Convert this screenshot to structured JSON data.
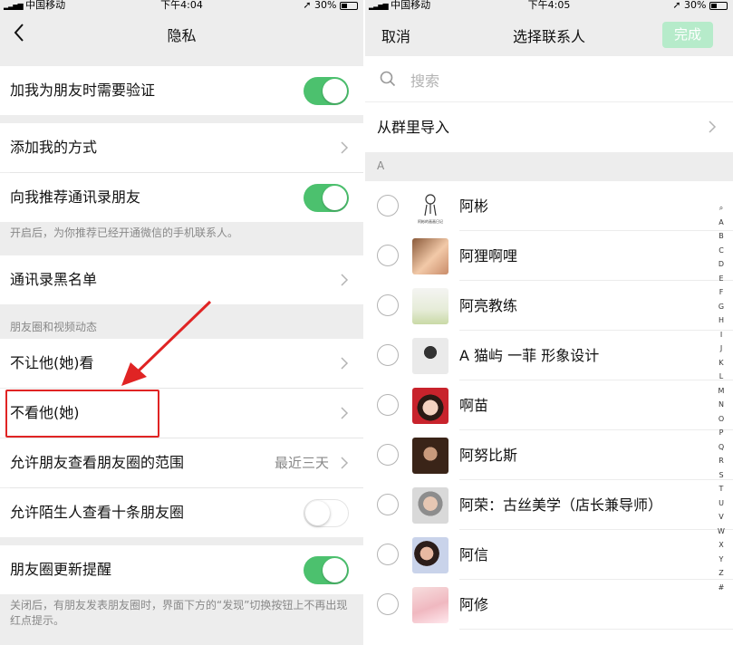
{
  "left": {
    "status": {
      "carrier": "中国移动",
      "time": "下午4:04",
      "battery": "30%"
    },
    "nav": {
      "title": "隐私"
    },
    "items": {
      "verify": "加我为朋友时需要验证",
      "add_methods": "添加我的方式",
      "recommend": "向我推荐通讯录朋友",
      "recommend_note": "开启后，为你推荐已经开通微信的手机联系人。",
      "blacklist": "通讯录黑名单",
      "moments_section": "朋友圈和视频动态",
      "hide_from": "不让他(她)看",
      "dont_see": "不看他(她)",
      "range": "允许朋友查看朋友圈的范围",
      "range_value": "最近三天",
      "strangers": "允许陌生人查看十条朋友圈",
      "moments_update": "朋友圈更新提醒",
      "update_note": "关闭后，有朋友发表朋友圈时，界面下方的“发现”切换按钮上不再出现红点提示。"
    },
    "toggles": {
      "verify": true,
      "recommend": true,
      "strangers": false,
      "moments_update": true
    }
  },
  "right": {
    "status": {
      "carrier": "中国移动",
      "time": "下午4:05",
      "battery": "30%"
    },
    "nav": {
      "cancel": "取消",
      "title": "选择联系人",
      "done": "完成"
    },
    "search": {
      "placeholder": "搜索"
    },
    "from_group": "从群里导入",
    "letter_header": "A",
    "avatar_caption": "阿彬的画画日记",
    "contacts": [
      "阿彬",
      "阿狸啊哩",
      "阿亮教练",
      "A 猫屿 一菲  形象设计",
      "啊苗",
      "阿努比斯",
      "阿荣：古丝美学（店长兼导师）",
      "阿信",
      "阿修"
    ],
    "index_letters": [
      "A",
      "B",
      "C",
      "D",
      "E",
      "F",
      "G",
      "H",
      "I",
      "J",
      "K",
      "L",
      "M",
      "N",
      "O",
      "P",
      "Q",
      "R",
      "S",
      "T",
      "U",
      "V",
      "W",
      "X",
      "Y",
      "Z",
      "#"
    ]
  }
}
